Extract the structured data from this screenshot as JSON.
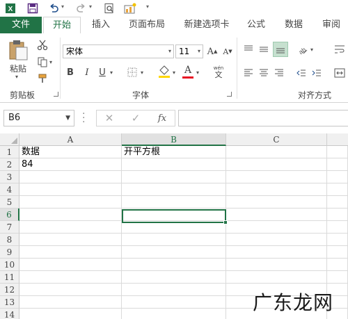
{
  "quick_access": {
    "icons": [
      "excel-logo-icon",
      "save-icon",
      "undo-icon",
      "redo-icon",
      "print-preview-icon",
      "new-chart-icon",
      "customize-icon"
    ]
  },
  "tabs": [
    {
      "label": "文件"
    },
    {
      "label": "开始"
    },
    {
      "label": "插入"
    },
    {
      "label": "页面布局"
    },
    {
      "label": "新建选项卡"
    },
    {
      "label": "公式"
    },
    {
      "label": "数据"
    },
    {
      "label": "审阅"
    }
  ],
  "ribbon": {
    "clipboard": {
      "paste_label": "粘贴",
      "group_label": "剪贴板"
    },
    "font": {
      "group_label": "字体",
      "font_name": "宋体",
      "font_size": "11",
      "bold": "B",
      "italic": "I",
      "underline": "U",
      "grow": "A",
      "shrink": "A",
      "font_color_glyph": "A",
      "phonetic": "wén"
    },
    "alignment": {
      "group_label": "对齐方式"
    }
  },
  "formula_bar": {
    "name_box": "B6",
    "cancel_glyph": "✕",
    "enter_glyph": "✓",
    "fx_glyph": "fx",
    "formula": ""
  },
  "grid": {
    "columns": [
      "A",
      "B",
      "C"
    ],
    "selected_column": "B",
    "rows": [
      "1",
      "2",
      "3",
      "4",
      "5",
      "6",
      "7",
      "8",
      "9",
      "10",
      "11",
      "12",
      "13",
      "14"
    ],
    "selected_row": "6",
    "cells": {
      "A1": "数据",
      "B1": "开平方根",
      "A2": "84"
    },
    "active_cell": "B6"
  },
  "watermark": "广东龙网",
  "colors": {
    "excel_green": "#217346",
    "font_color_bar": "#e81123",
    "fill_color_bar": "#ffd700"
  }
}
